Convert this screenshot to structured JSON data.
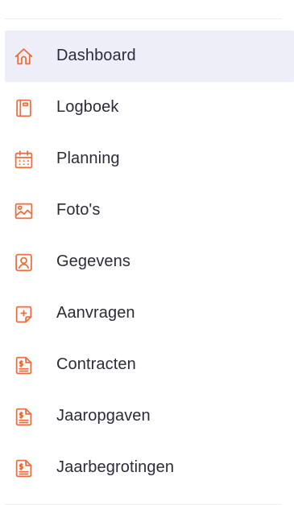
{
  "sidebar": {
    "accent_color": "#ec6e3e",
    "active_background": "#eeeef8",
    "active_item": "Dashboard",
    "items": [
      {
        "label": "Dashboard",
        "icon": "home-icon"
      },
      {
        "label": "Logboek",
        "icon": "notebook-icon"
      },
      {
        "label": "Planning",
        "icon": "calendar-icon"
      },
      {
        "label": "Foto's",
        "icon": "image-icon"
      },
      {
        "label": "Gegevens",
        "icon": "user-profile-icon"
      },
      {
        "label": "Aanvragen",
        "icon": "add-note-icon"
      },
      {
        "label": "Contracten",
        "icon": "dollar-document-icon"
      },
      {
        "label": "Jaaropgaven",
        "icon": "dollar-document-icon"
      },
      {
        "label": "Jaarbegrotingen",
        "icon": "dollar-document-icon"
      }
    ]
  }
}
